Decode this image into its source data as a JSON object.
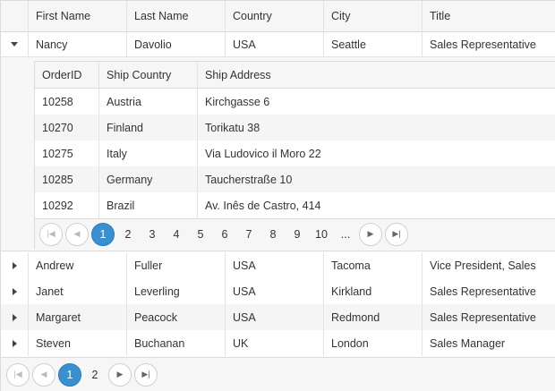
{
  "grid": {
    "columns": [
      "First Name",
      "Last Name",
      "Country",
      "City",
      "Title"
    ],
    "expanded_row": {
      "first": "Nancy",
      "last": "Davolio",
      "country": "USA",
      "city": "Seattle",
      "title": "Sales Representative"
    },
    "rows": [
      {
        "first": "Andrew",
        "last": "Fuller",
        "country": "USA",
        "city": "Tacoma",
        "title": "Vice President, Sales"
      },
      {
        "first": "Janet",
        "last": "Leverling",
        "country": "USA",
        "city": "Kirkland",
        "title": "Sales Representative"
      },
      {
        "first": "Margaret",
        "last": "Peacock",
        "country": "USA",
        "city": "Redmond",
        "title": "Sales Representative"
      },
      {
        "first": "Steven",
        "last": "Buchanan",
        "country": "UK",
        "city": "London",
        "title": "Sales Manager"
      }
    ],
    "pager": {
      "pages": [
        "1",
        "2"
      ],
      "selected": "1"
    }
  },
  "detail": {
    "columns": [
      "OrderID",
      "Ship Country",
      "Ship Address"
    ],
    "rows": [
      {
        "id": "10258",
        "country": "Austria",
        "address": "Kirchgasse 6"
      },
      {
        "id": "10270",
        "country": "Finland",
        "address": "Torikatu 38"
      },
      {
        "id": "10275",
        "country": "Italy",
        "address": "Via Ludovico il Moro 22"
      },
      {
        "id": "10285",
        "country": "Germany",
        "address": "Taucherstraße 10"
      },
      {
        "id": "10292",
        "country": "Brazil",
        "address": "Av. Inês de Castro, 414"
      }
    ],
    "pager": {
      "pages": [
        "1",
        "2",
        "3",
        "4",
        "5",
        "6",
        "7",
        "8",
        "9",
        "10",
        "..."
      ],
      "selected": "1"
    }
  },
  "icons": {
    "first": "first-page-icon",
    "prev": "previous-page-icon",
    "next": "next-page-icon",
    "last": "last-page-icon",
    "expand": "expand-arrow-icon",
    "collapse": "collapse-arrow-icon"
  },
  "colors": {
    "accent": "#3a8fd0",
    "header_bg": "#f6f6f6",
    "alt_row": "#f5f5f5",
    "border": "#dbdbdb"
  }
}
